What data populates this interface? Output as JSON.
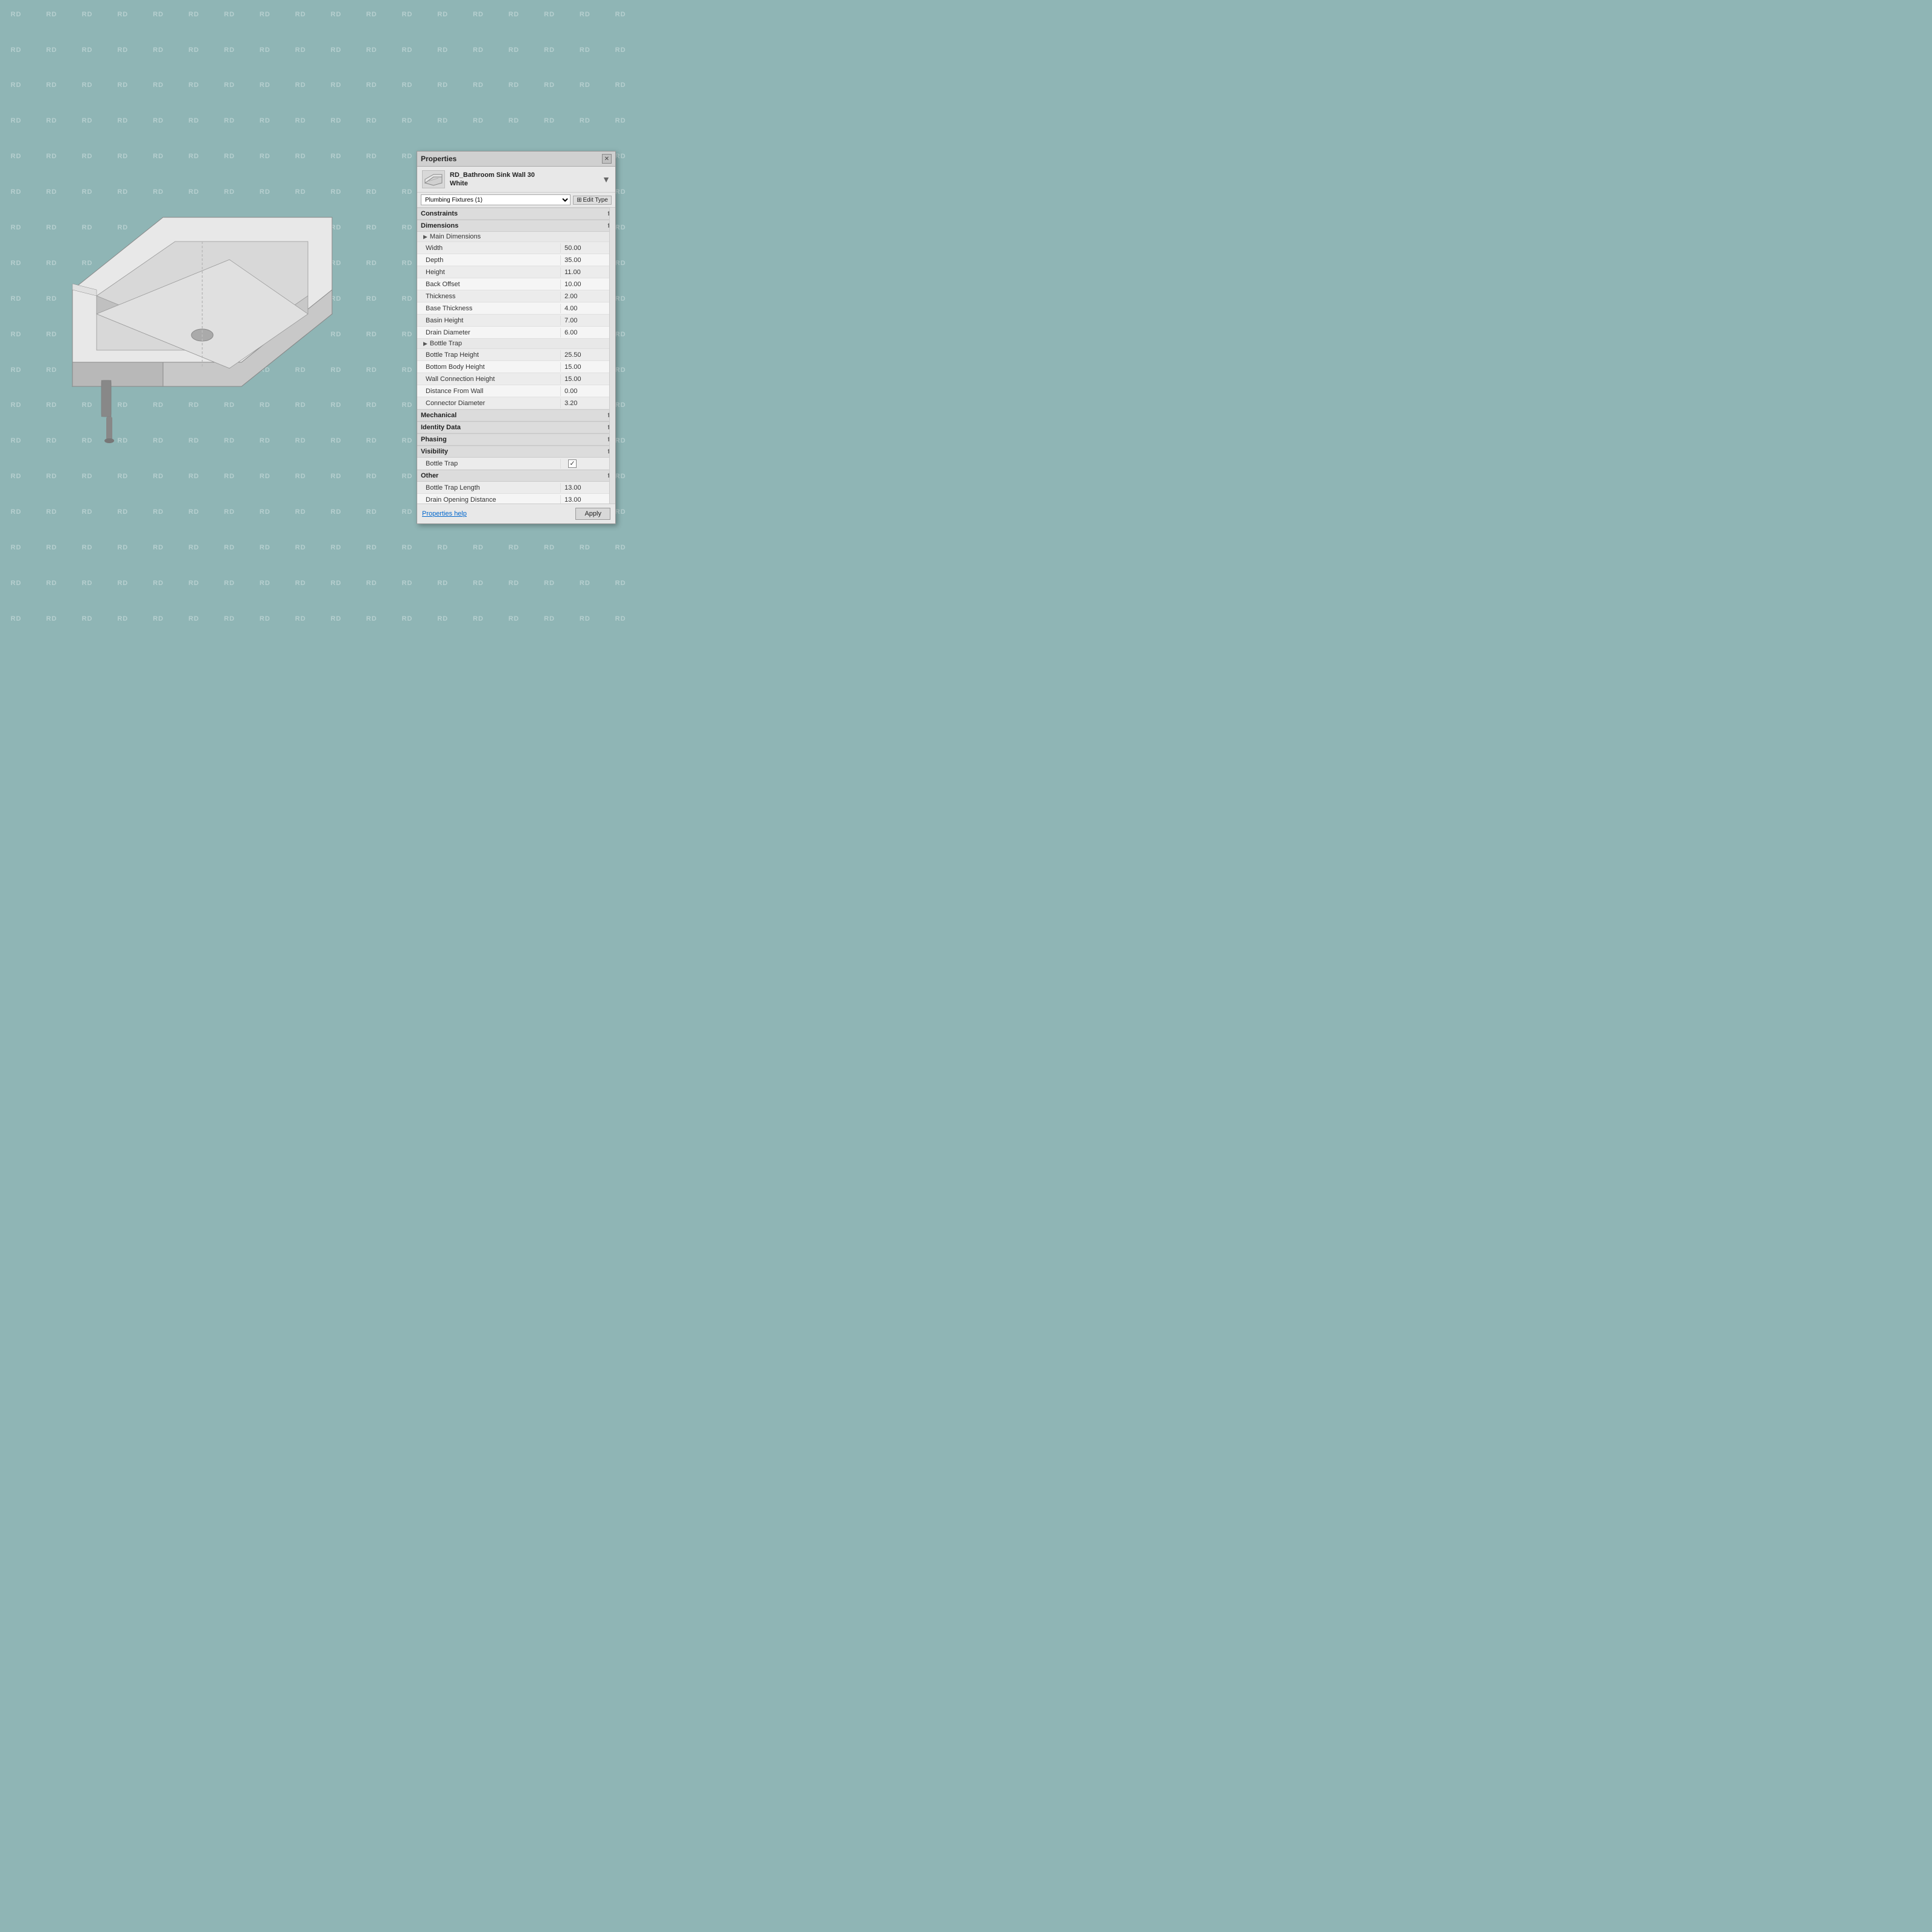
{
  "background": {
    "color": "#8fb5b5",
    "watermark": "RD"
  },
  "panel": {
    "title": "Properties",
    "close_label": "✕",
    "header": {
      "icon_alt": "sink-icon",
      "name_line1": "RD_Bathroom Sink Wall 30",
      "name_line2": "White"
    },
    "dropdown": {
      "value": "Plumbing Fixtures (1)",
      "options": [
        "Plumbing Fixtures (1)"
      ]
    },
    "edit_type_label": "Edit Type",
    "sections": {
      "constraints": {
        "label": "Constraints"
      },
      "dimensions": {
        "label": "Dimensions",
        "subsections": {
          "main": {
            "label": "Main Dimensions"
          }
        },
        "rows": [
          {
            "label": "Width",
            "value": "50.00"
          },
          {
            "label": "Depth",
            "value": "35.00"
          },
          {
            "label": "Height",
            "value": "11.00"
          },
          {
            "label": "Back Offset",
            "value": "10.00"
          },
          {
            "label": "Thickness",
            "value": "2.00"
          },
          {
            "label": "Base Thickness",
            "value": "4.00"
          },
          {
            "label": "Basin Height",
            "value": "7.00"
          },
          {
            "label": "Drain Diameter",
            "value": "6.00"
          }
        ],
        "bottle_trap_subsection": {
          "label": "Bottle Trap"
        },
        "bottle_trap_rows": [
          {
            "label": "Bottle Trap Height",
            "value": "25.50"
          },
          {
            "label": "Bottom Body Height",
            "value": "15.00"
          },
          {
            "label": "Wall Connection Height",
            "value": "15.00"
          },
          {
            "label": "Distance From Wall",
            "value": "0.00"
          },
          {
            "label": "Connector Diameter",
            "value": "3.20"
          }
        ]
      },
      "mechanical": {
        "label": "Mechanical"
      },
      "identity_data": {
        "label": "Identity Data"
      },
      "phasing": {
        "label": "Phasing"
      },
      "visibility": {
        "label": "Visibility",
        "rows": [
          {
            "label": "Bottle Trap",
            "value": "checked",
            "type": "checkbox"
          }
        ]
      },
      "other": {
        "label": "Other",
        "rows": [
          {
            "label": "Bottle Trap Length",
            "value": "13.00"
          },
          {
            "label": "Drain Opening Distance",
            "value": "13.00"
          }
        ]
      }
    },
    "footer": {
      "help_label": "Properties help",
      "apply_label": "Apply"
    }
  }
}
